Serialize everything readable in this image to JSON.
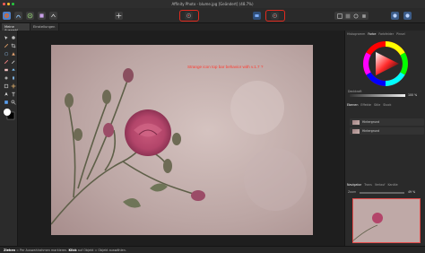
{
  "window": {
    "title": "Affinity Photo - blume.jpg [Geändert] (48.7%)"
  },
  "tabs": [
    {
      "label": "Meine Auswahl",
      "active": true
    },
    {
      "label": "Einstellungen",
      "active": false
    }
  ],
  "annotation": {
    "text": "Strange icon top bar behavior with v.1.7 ?",
    "color": "#ff3b30"
  },
  "right_panel": {
    "color_tabs": [
      "Histogramm",
      "Farbe",
      "Farbfelder",
      "Pinsel"
    ],
    "layers_tabs": [
      "Ebenen",
      "Effekte",
      "Stile",
      "Stock"
    ],
    "layers": [
      {
        "name": "Hintergrund"
      },
      {
        "name": "Hintergrund"
      }
    ],
    "navigator_tabs": [
      "Navigator",
      "Trans",
      "Verlauf",
      "Kanäle"
    ],
    "opacity_label": "Deckkraft",
    "opacity_value": "100 %",
    "zoom_label": "Zoom",
    "zoom_value": "49 %"
  },
  "status": {
    "label": "Ziehen",
    "text_part1": "= Per Auswahlrahmen markieren.",
    "click_label": "Klick",
    "text_part2": "auf Objekt = Objekt auswählen."
  },
  "colors": {
    "accent_highlight": "#e02a1e",
    "ui_bg": "#2a2a2a",
    "canvas_bg": "#1e1e1e"
  },
  "icons": {
    "toolbar_left": [
      "persona-photo-icon",
      "persona-liquify-icon",
      "persona-develop-icon",
      "persona-tonemapping-icon",
      "persona-export-icon"
    ],
    "toolbar_center": [
      "move-icon",
      "assistant-icon",
      "snapping-icon"
    ],
    "toolbar_right": [
      "quick-mask-icon",
      "selection-add-icon",
      "selection-subtract-icon",
      "selection-intersect-icon",
      "arrange-icon",
      "studio-icon"
    ]
  }
}
